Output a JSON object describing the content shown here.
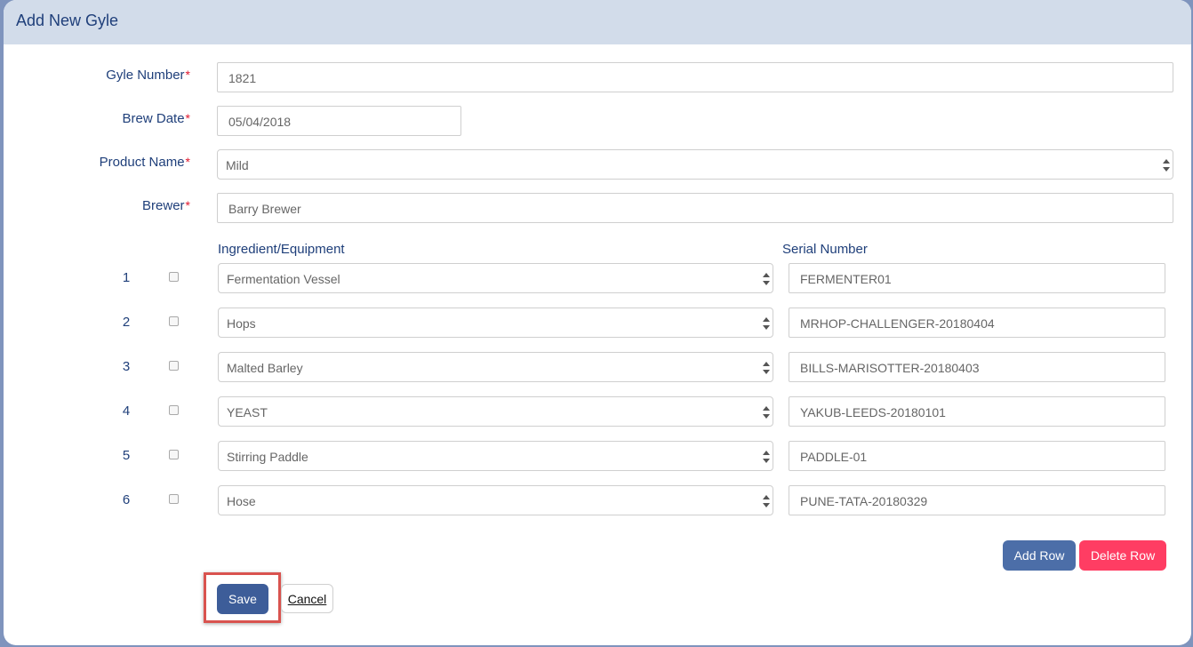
{
  "panel": {
    "title": "Add New Gyle"
  },
  "form": {
    "gyle_number": {
      "label": "Gyle Number",
      "value": "1821"
    },
    "brew_date": {
      "label": "Brew Date",
      "value": "05/04/2018"
    },
    "product_name": {
      "label": "Product Name",
      "value": "Mild"
    },
    "brewer": {
      "label": "Brewer",
      "value": "Barry Brewer"
    },
    "required_marker": "*"
  },
  "table": {
    "headers": {
      "ingredient": "Ingredient/Equipment",
      "serial": "Serial Number"
    },
    "rows": [
      {
        "num": "1",
        "ingredient": "Fermentation Vessel",
        "serial": "FERMENTER01",
        "checked": false
      },
      {
        "num": "2",
        "ingredient": "Hops",
        "serial": "MRHOP-CHALLENGER-20180404",
        "checked": false
      },
      {
        "num": "3",
        "ingredient": "Malted Barley",
        "serial": "BILLS-MARISOTTER-20180403",
        "checked": false
      },
      {
        "num": "4",
        "ingredient": "YEAST",
        "serial": "YAKUB-LEEDS-20180101",
        "checked": false
      },
      {
        "num": "5",
        "ingredient": "Stirring Paddle",
        "serial": "PADDLE-01",
        "checked": false
      },
      {
        "num": "6",
        "ingredient": "Hose",
        "serial": "PUNE-TATA-20180329",
        "checked": false
      }
    ]
  },
  "buttons": {
    "add_row": "Add Row",
    "delete_row": "Delete Row",
    "save": "Save",
    "cancel": "Cancel"
  },
  "colors": {
    "header_bg": "#d2dcea",
    "label_text": "#1f3f7a",
    "required": "#e0192f",
    "primary_button": "#4c6ea8",
    "danger_button": "#ff3d63",
    "highlight_border": "#d9534f"
  }
}
